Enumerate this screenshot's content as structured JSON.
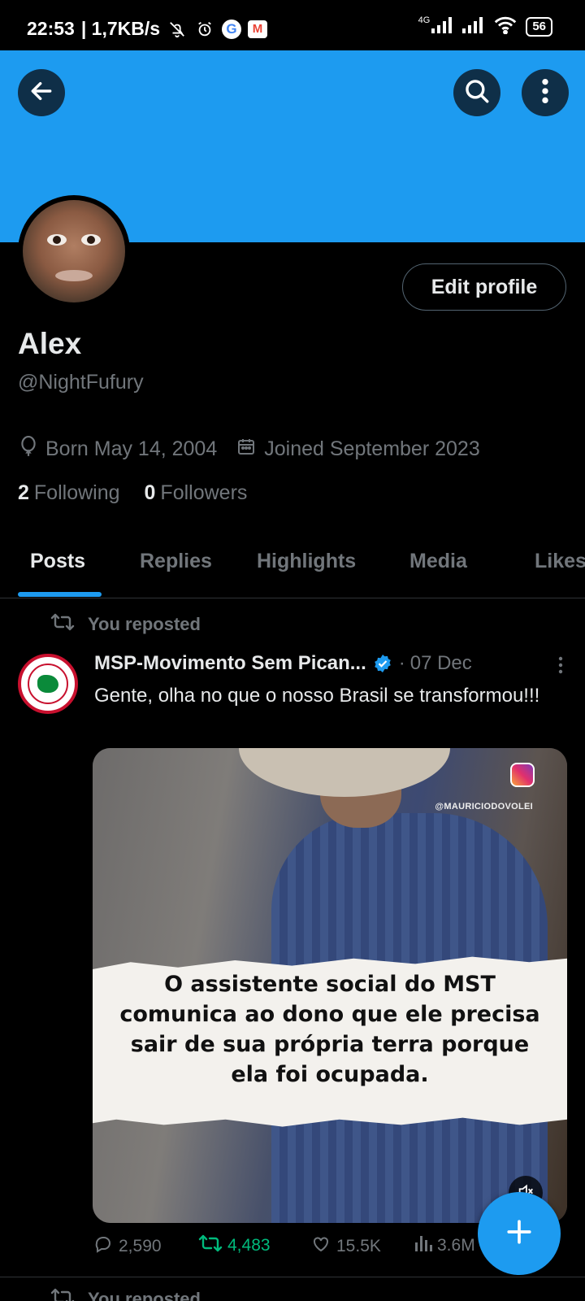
{
  "status_bar": {
    "time": "22:53",
    "speed": "| 1,7KB/s",
    "network": "4G",
    "battery": "56"
  },
  "header": {
    "back_icon": "arrow-left-icon",
    "search_icon": "search-icon",
    "more_icon": "more-vertical-icon",
    "banner_color": "#1d9bf0"
  },
  "profile": {
    "edit_label": "Edit profile",
    "name": "Alex",
    "handle": "@NightFufury",
    "born": "Born May 14, 2004",
    "joined": "Joined September 2023",
    "following_count": "2",
    "following_label": "Following",
    "followers_count": "0",
    "followers_label": "Followers"
  },
  "tabs": [
    {
      "label": "Posts",
      "active": true
    },
    {
      "label": "Replies",
      "active": false
    },
    {
      "label": "Highlights",
      "active": false
    },
    {
      "label": "Media",
      "active": false
    },
    {
      "label": "Likes",
      "active": false
    }
  ],
  "post": {
    "repost_label": "You reposted",
    "author": "MSP-Movimento Sem Pican...",
    "separator": "·",
    "date": "07 Dec",
    "text": "Gente, olha no que o nosso Brasil se transformou!!!",
    "media_watermark": "@MAURICIODOVOLEI",
    "media_caption": "O assistente social do MST comunica ao dono que ele precisa sair de sua própria terra porque ela foi ocupada.",
    "replies": "2,590",
    "reposts": "4,483",
    "likes": "15.5K",
    "views": "3.6M"
  },
  "next_post": {
    "repost_label": "You reposted"
  },
  "colors": {
    "accent": "#1d9bf0",
    "repost_green": "#00ba7c",
    "muted": "#71767b"
  }
}
